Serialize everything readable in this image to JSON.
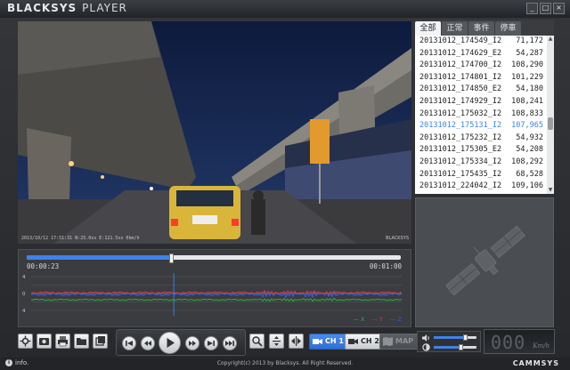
{
  "window": {
    "title_part1": "BLACKSYS",
    "title_part2": "PLAYER",
    "minimize": "_",
    "maximize": "□",
    "close": "×"
  },
  "video": {
    "stamp": "2013/10/12 17:51:31 N:25.0xx E:121.5xx 0km/h",
    "brand": "BLACKSYS"
  },
  "file_tabs": [
    {
      "label": "全部",
      "active": true
    },
    {
      "label": "正常",
      "active": false
    },
    {
      "label": "事件",
      "active": false
    },
    {
      "label": "停車",
      "active": false
    }
  ],
  "files": [
    {
      "name": "20131012_174549_I2",
      "size": "71,172"
    },
    {
      "name": "20131012_174629_E2",
      "size": "54,287"
    },
    {
      "name": "20131012_174700_I2",
      "size": "108,290"
    },
    {
      "name": "20131012_174801_I2",
      "size": "101,229"
    },
    {
      "name": "20131012_174850_E2",
      "size": "54,180"
    },
    {
      "name": "20131012_174929_I2",
      "size": "108,241"
    },
    {
      "name": "20131012_175032_I2",
      "size": "108,833"
    },
    {
      "name": "20131012_175131_I2",
      "size": "107,965",
      "selected": true
    },
    {
      "name": "20131012_175232_I2",
      "size": "54,932"
    },
    {
      "name": "20131012_175305_E2",
      "size": "54,208"
    },
    {
      "name": "20131012_175334_I2",
      "size": "108,292"
    },
    {
      "name": "20131012_175435_I2",
      "size": "68,528"
    },
    {
      "name": "20131012_224042_I2",
      "size": "109,106"
    }
  ],
  "playback": {
    "current_time": "00:00:23",
    "end_time": "00:01:00",
    "progress": 0.385
  },
  "gsensor": {
    "y_ticks": [
      "4",
      "",
      "0",
      "",
      "4"
    ],
    "legend": [
      "X",
      "Y",
      "Z"
    ],
    "colors": {
      "X": "#2fb33a",
      "Y": "#e23a36",
      "Z": "#3a5df0"
    }
  },
  "toolbar": {
    "icons": [
      "settings-icon",
      "snapshot-icon",
      "print-icon",
      "folder-icon",
      "export-icon"
    ],
    "playback_icons": [
      "prev-file-icon",
      "rewind-icon",
      "play-icon",
      "forward-icon",
      "next-file-icon",
      "last-icon"
    ],
    "zoom_icons": [
      "zoom-icon",
      "fit-icon",
      "mirror-icon"
    ],
    "ch1_label": "CH 1",
    "ch2_label": "CH 2",
    "map_label": "MAP"
  },
  "audio": {
    "volume": 0.72,
    "brightness": 0.62
  },
  "speed": {
    "digits": "000",
    "unit": "Km/h"
  },
  "status": {
    "info_label": "info.",
    "copyright": "Copyright(c) 2013 by Blacksys. All Right Reserved.",
    "brand": "CAMMSYS"
  },
  "colors": {
    "accent": "#3f83e8",
    "selected_file": "#3d84e6"
  }
}
